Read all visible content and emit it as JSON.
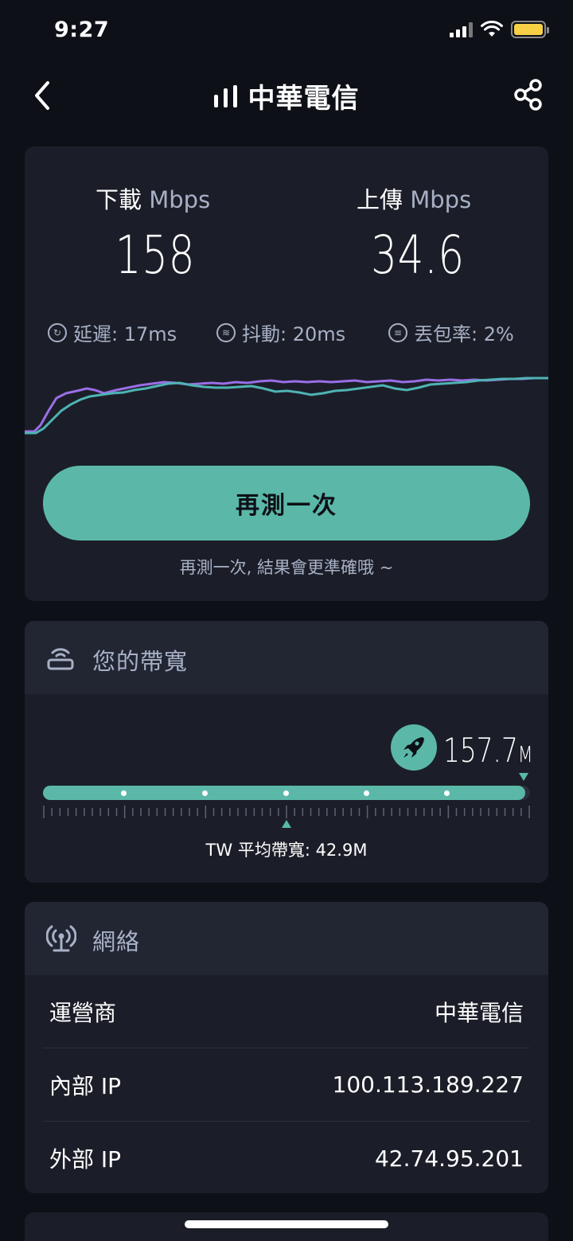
{
  "status_bar": {
    "time": "9:27"
  },
  "header": {
    "title": "中華電信"
  },
  "speed": {
    "download_label": "下載",
    "download_unit": "Mbps",
    "download_value": "158",
    "upload_label": "上傳",
    "upload_unit": "Mbps",
    "upload_value": "34.6"
  },
  "metrics": {
    "latency": "延遲: 17ms",
    "jitter": "抖動: 20ms",
    "packet_loss": "丟包率: 2%"
  },
  "colors": {
    "accent": "#5bb8a8",
    "download_line": "#9b6ee6",
    "upload_line": "#4fb3b4"
  },
  "retest": {
    "button_label": "再測一次",
    "hint": "再測一次, 結果會更準確哦 ~"
  },
  "bandwidth": {
    "title": "您的帶寬",
    "value": "157.7",
    "unit": "M",
    "fill_fraction": 0.99,
    "average_fraction": 0.5,
    "tw_average": "TW 平均帶寬: 42.9M"
  },
  "network": {
    "title": "網絡",
    "rows": [
      {
        "label": "運營商",
        "value": "中華電信"
      },
      {
        "label": "內部 IP",
        "value": "100.113.189.227"
      },
      {
        "label": "外部 IP",
        "value": "42.74.95.201"
      }
    ]
  }
}
